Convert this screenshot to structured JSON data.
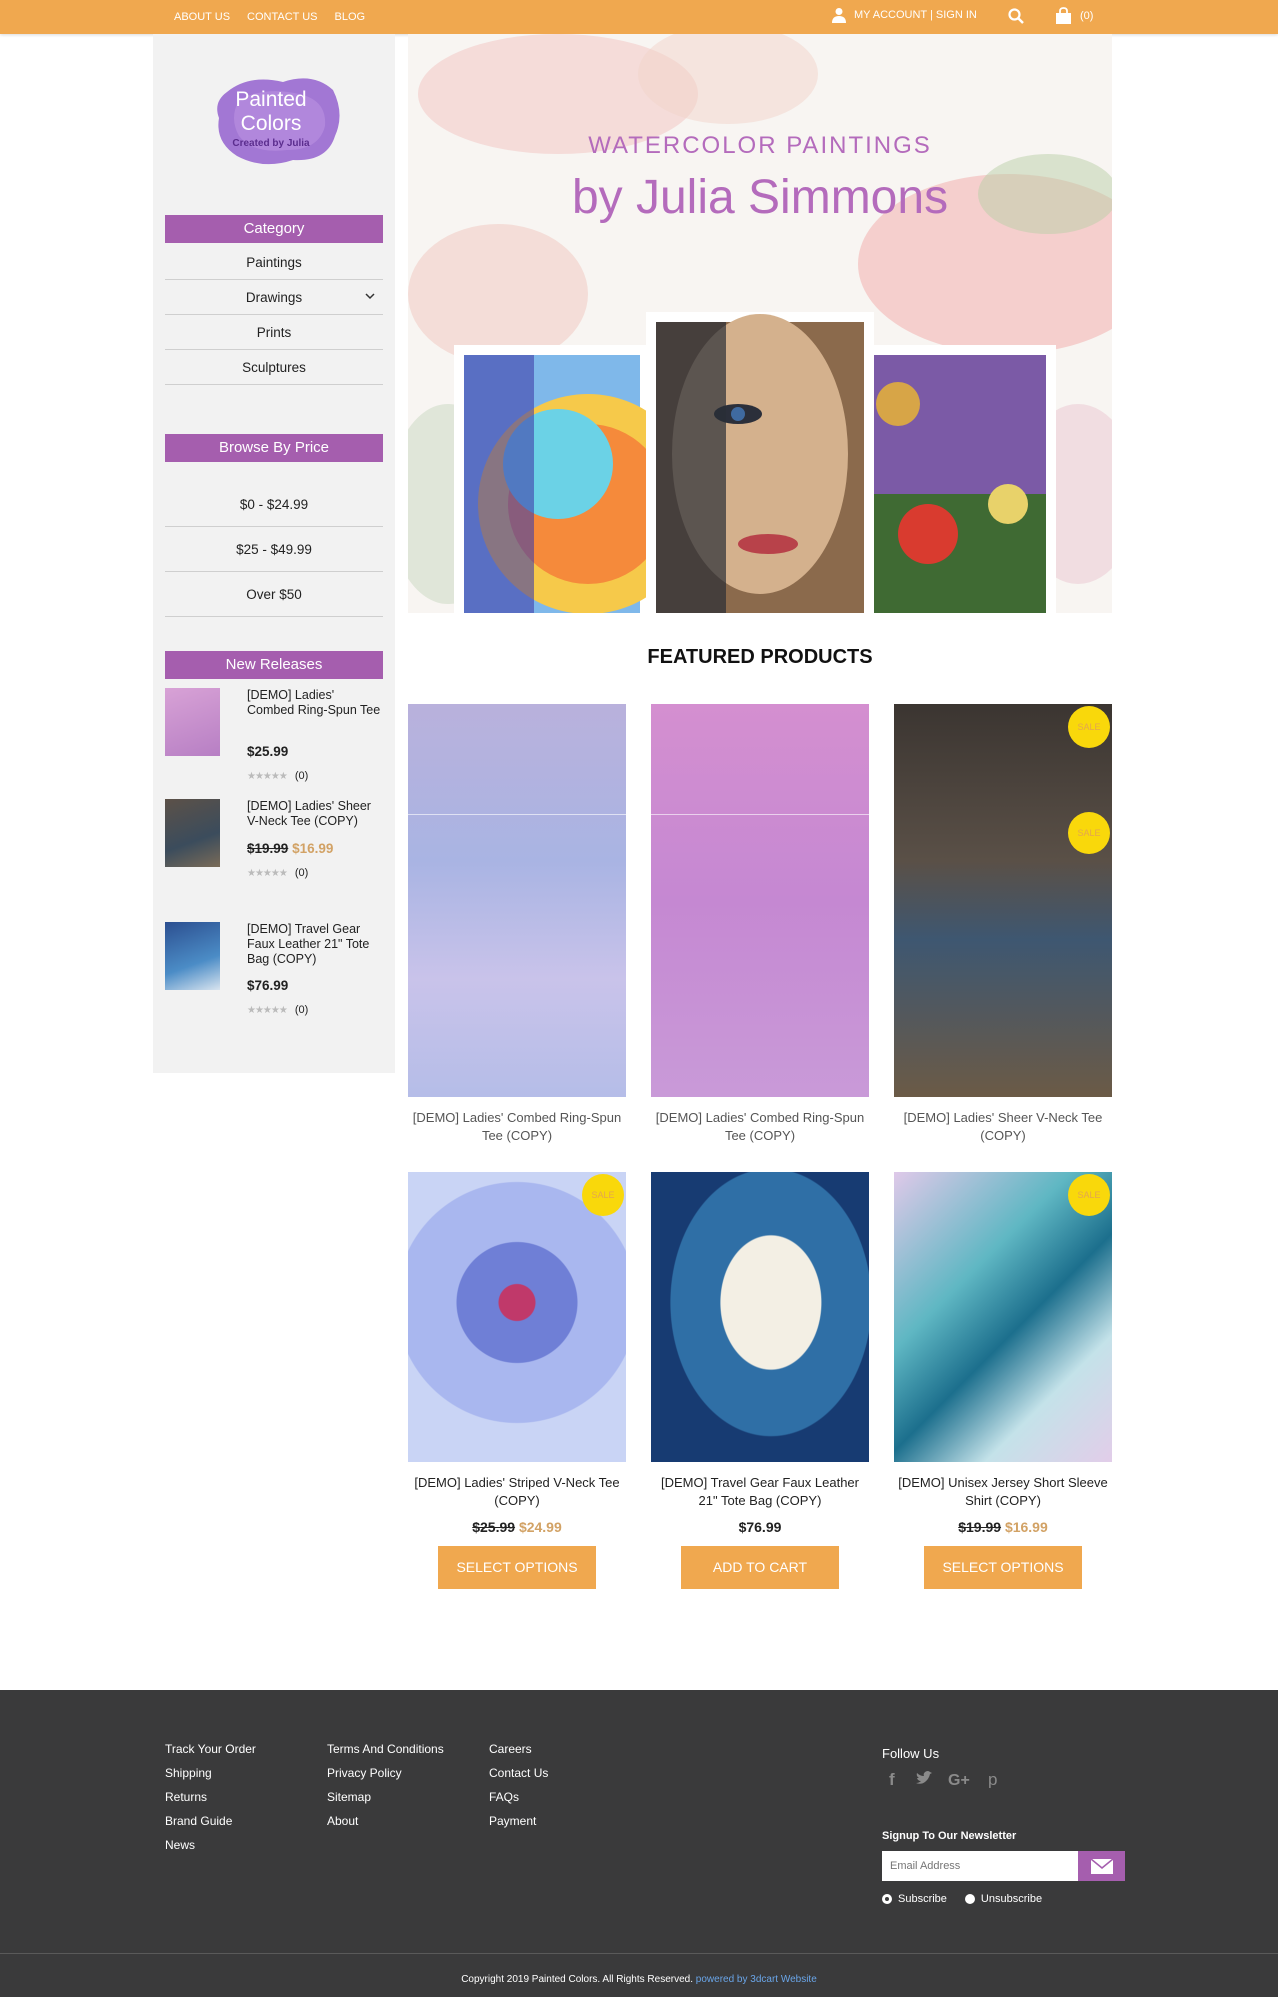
{
  "topbar": {
    "links": [
      "ABOUT US",
      "CONTACT US",
      "BLOG"
    ],
    "account_label": "MY ACCOUNT | SIGN IN",
    "cart_count": "(0)"
  },
  "logo": {
    "line1": "Painted",
    "line2": "Colors",
    "tagline": "Created by Julia"
  },
  "sidebar": {
    "category_title": "Category",
    "categories": [
      "Paintings",
      "Drawings",
      "Prints",
      "Sculptures"
    ],
    "price_title": "Browse By Price",
    "prices": [
      "$0 - $24.99",
      "$25 - $49.99",
      "Over $50"
    ],
    "releases_title": "New Releases",
    "releases": [
      {
        "title": "[DEMO] Ladies' Combed Ring-Spun Tee",
        "price": "$25.99",
        "old_price": "",
        "reviews": "(0)"
      },
      {
        "title": "[DEMO] Ladies' Sheer V-Neck Tee (COPY)",
        "price": "$16.99",
        "old_price": "$19.99",
        "reviews": "(0)"
      },
      {
        "title": "[DEMO] Travel Gear Faux Leather 21\" Tote Bag (COPY)",
        "price": "$76.99",
        "old_price": "",
        "reviews": "(0)"
      }
    ]
  },
  "hero": {
    "subtitle": "WATERCOLOR PAINTINGS",
    "title": "by Julia Simmons"
  },
  "featured": {
    "title": "FEATURED PRODUCTS",
    "products": [
      {
        "name": "[DEMO] Ladies' Combed Ring-Spun Tee (COPY)",
        "badge": ""
      },
      {
        "name": "[DEMO] Ladies' Combed Ring-Spun Tee (COPY)",
        "badge": ""
      },
      {
        "name": "[DEMO] Ladies' Sheer V-Neck Tee (COPY)",
        "badge": "SALE"
      },
      {
        "name": "[DEMO] Ladies' Striped V-Neck Tee (COPY)",
        "badge": "SALE",
        "old_price": "$25.99",
        "price": "$24.99",
        "button": "SELECT OPTIONS"
      },
      {
        "name": "[DEMO] Travel Gear Faux Leather 21\" Tote Bag (COPY)",
        "badge": "",
        "old_price": "",
        "price": "$76.99",
        "button": "ADD TO CART"
      },
      {
        "name": "[DEMO] Unisex Jersey Short Sleeve Shirt (COPY)",
        "badge": "SALE",
        "old_price": "$19.99",
        "price": "$16.99",
        "button": "SELECT OPTIONS"
      }
    ],
    "second_badge": "SALE"
  },
  "footer": {
    "col1": [
      "Track Your Order",
      "Shipping",
      "Returns",
      "Brand Guide",
      "News"
    ],
    "col2": [
      "Terms And Conditions",
      "Privacy Policy",
      "Sitemap",
      "About"
    ],
    "col3": [
      "Careers",
      "Contact Us",
      "FAQs",
      "Payment"
    ],
    "follow": "Follow Us",
    "newsletter_title": "Signup To Our Newsletter",
    "email_placeholder": "Email Address",
    "subscribe": "Subscribe",
    "unsubscribe": "Unsubscribe",
    "copyright": "Copyright 2019 Painted Colors. All Rights Reserved.",
    "powered": "powered by 3dcart Website"
  }
}
